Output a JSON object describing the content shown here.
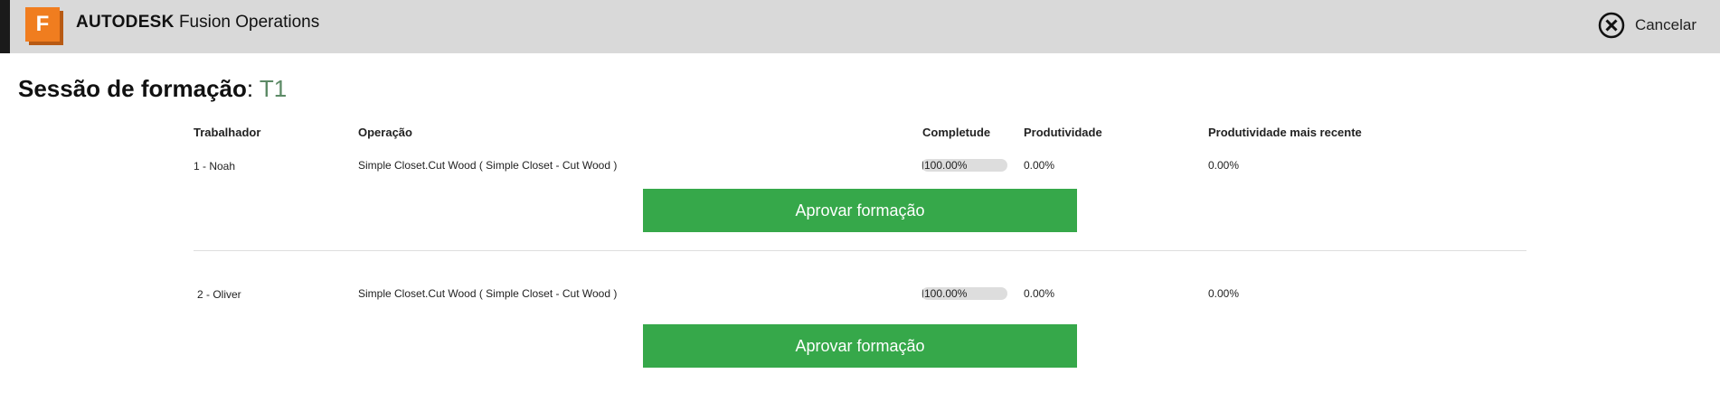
{
  "header": {
    "logo_letter": "F",
    "brand_bold": "AUTODESK",
    "brand_product": " Fusion Operations",
    "cancel_label": "Cancelar",
    "logo_color": "#f07d1f"
  },
  "page": {
    "title_bold": "Sessão de formação",
    "title_sep": ": ",
    "title_name": "T1"
  },
  "table": {
    "columns": {
      "worker": "Trabalhador",
      "operation": "Operação",
      "completeness": "Completude",
      "productivity": "Produtividade",
      "recent_productivity": "Produtividade mais recente"
    },
    "rows": [
      {
        "worker": "1 - Noah",
        "operation": "Simple Closet.Cut Wood ( Simple Closet - Cut Wood )",
        "completeness": "100.00%",
        "completeness_value": 1.0,
        "productivity": "0.00%",
        "recent_productivity": "0.00%",
        "approve_label": "Aprovar formação"
      },
      {
        "worker": "2 - Oliver",
        "operation": "Simple Closet.Cut Wood ( Simple Closet - Cut Wood )",
        "completeness": "100.00%",
        "completeness_value": 1.0,
        "productivity": "0.00%",
        "recent_productivity": "0.00%",
        "approve_label": "Aprovar formação"
      }
    ]
  },
  "colors": {
    "approve_button": "#36a84a",
    "title_name": "#5c8a66"
  }
}
